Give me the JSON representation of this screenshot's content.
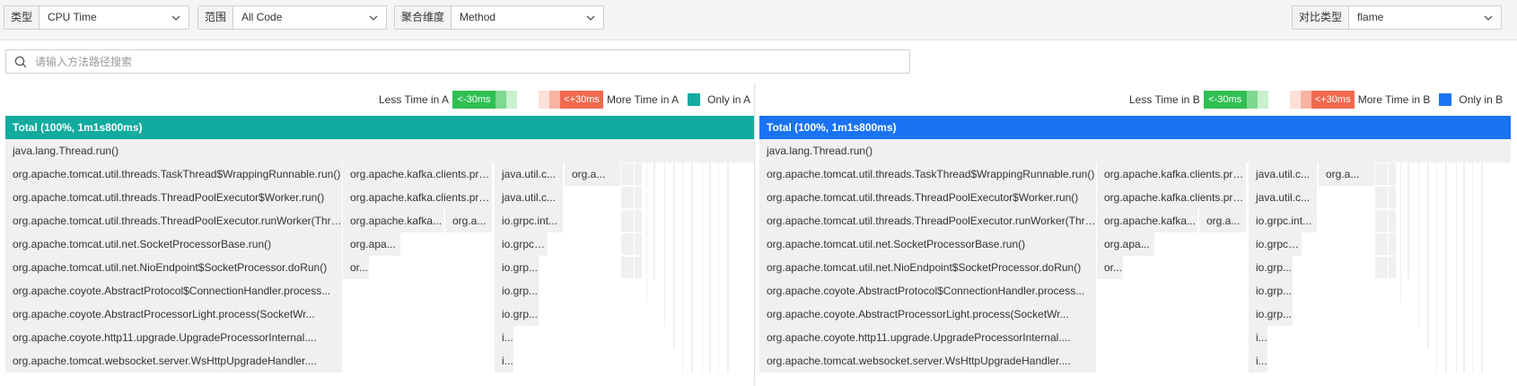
{
  "toolbar": {
    "type": {
      "label": "类型",
      "value": "CPU Time"
    },
    "scope": {
      "label": "范围",
      "value": "All Code"
    },
    "aggregate": {
      "label": "聚合维度",
      "value": "Method"
    },
    "compare": {
      "label": "对比类型",
      "value": "flame"
    }
  },
  "search": {
    "placeholder": "请输入方法路径搜索"
  },
  "colors": {
    "panel_a": "#12ab9f",
    "panel_b": "#1a73f5",
    "less": "#2fbf52",
    "more": "#f06a4f"
  },
  "panels": [
    {
      "id": "A",
      "badge": "A",
      "legend": {
        "less_text": "Less Time in A",
        "less_cell": "<-30ms",
        "more_cell": "<+30ms",
        "more_text": "More Time in A",
        "only_text": "Only in A"
      },
      "total": "Total (100%, 1m1s800ms)",
      "rows": [
        [
          "java.lang.Thread.run()"
        ],
        [
          "org.apache.tomcat.util.threads.TaskThread$WrappingRunnable.run()",
          "org.apache.kafka.clients.pro...",
          "java.util.c...",
          "org.a..."
        ],
        [
          "org.apache.tomcat.util.threads.ThreadPoolExecutor$Worker.run()",
          "org.apache.kafka.clients.pro...",
          "java.util.c..."
        ],
        [
          "org.apache.tomcat.util.threads.ThreadPoolExecutor.runWorker(Thread...",
          "org.apache.kafka...",
          "org.a...",
          "io.grpc.int..."
        ],
        [
          "org.apache.tomcat.util.net.SocketProcessorBase.run()",
          "org.apa...",
          "io.grpc.i..."
        ],
        [
          "org.apache.tomcat.util.net.NioEndpoint$SocketProcessor.doRun()",
          "or...",
          "io.grp..."
        ],
        [
          "org.apache.coyote.AbstractProtocol$ConnectionHandler.process...",
          "io.grp..."
        ],
        [
          "org.apache.coyote.AbstractProcessorLight.process(SocketWr...",
          "io.grp..."
        ],
        [
          "org.apache.coyote.http11.upgrade.UpgradeProcessorInternal....",
          "i..."
        ],
        [
          "org.apache.tomcat.websocket.server.WsHttpUpgradeHandler....",
          "i..."
        ]
      ]
    },
    {
      "id": "B",
      "badge": "B",
      "legend": {
        "less_text": "Less Time in B",
        "less_cell": "<-30ms",
        "more_cell": "<+30ms",
        "more_text": "More Time in B",
        "only_text": "Only in B"
      },
      "total": "Total (100%, 1m1s800ms)",
      "rows": [
        [
          "java.lang.Thread.run()"
        ],
        [
          "org.apache.tomcat.util.threads.TaskThread$WrappingRunnable.run()",
          "org.apache.kafka.clients.pro...",
          "java.util.c...",
          "org.a..."
        ],
        [
          "org.apache.tomcat.util.threads.ThreadPoolExecutor$Worker.run()",
          "org.apache.kafka.clients.pro...",
          "java.util.c..."
        ],
        [
          "org.apache.tomcat.util.threads.ThreadPoolExecutor.runWorker(Thread...",
          "org.apache.kafka...",
          "org.a...",
          "io.grpc.int..."
        ],
        [
          "org.apache.tomcat.util.net.SocketProcessorBase.run()",
          "org.apa...",
          "io.grpc.i..."
        ],
        [
          "org.apache.tomcat.util.net.NioEndpoint$SocketProcessor.doRun()",
          "or...",
          "io.grp..."
        ],
        [
          "org.apache.coyote.AbstractProtocol$ConnectionHandler.process...",
          "io.grp..."
        ],
        [
          "org.apache.coyote.AbstractProcessorLight.process(SocketWr...",
          "io.grp..."
        ],
        [
          "org.apache.coyote.http11.upgrade.UpgradeProcessorInternal....",
          "i..."
        ],
        [
          "org.apache.tomcat.websocket.server.WsHttpUpgradeHandler....",
          "i..."
        ]
      ]
    }
  ]
}
